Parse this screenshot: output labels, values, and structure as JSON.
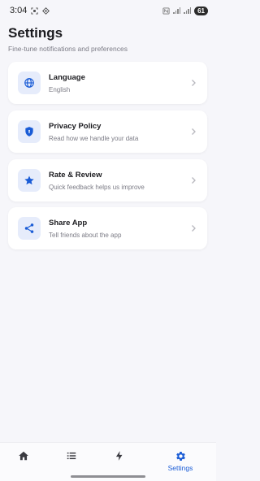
{
  "status_bar": {
    "time": "3:04",
    "battery": "61"
  },
  "header": {
    "title": "Settings",
    "subtitle": "Fine-tune notifications and preferences"
  },
  "items": [
    {
      "title": "Language",
      "description": "English",
      "icon": "globe-icon"
    },
    {
      "title": "Privacy Policy",
      "description": "Read how we handle your data",
      "icon": "shield-icon"
    },
    {
      "title": "Rate & Review",
      "description": "Quick feedback helps us improve",
      "icon": "star-icon"
    },
    {
      "title": "Share App",
      "description": "Tell friends about the app",
      "icon": "share-icon"
    }
  ],
  "bottom_nav": {
    "items": [
      {
        "icon": "home-icon",
        "label": ""
      },
      {
        "icon": "list-icon",
        "label": ""
      },
      {
        "icon": "bolt-icon",
        "label": ""
      },
      {
        "icon": "gear-icon",
        "label": "Settings",
        "active": true
      }
    ]
  },
  "colors": {
    "accent": "#1a5cd6",
    "icon_bg": "#e6ecfb",
    "background": "#f6f6fa"
  }
}
